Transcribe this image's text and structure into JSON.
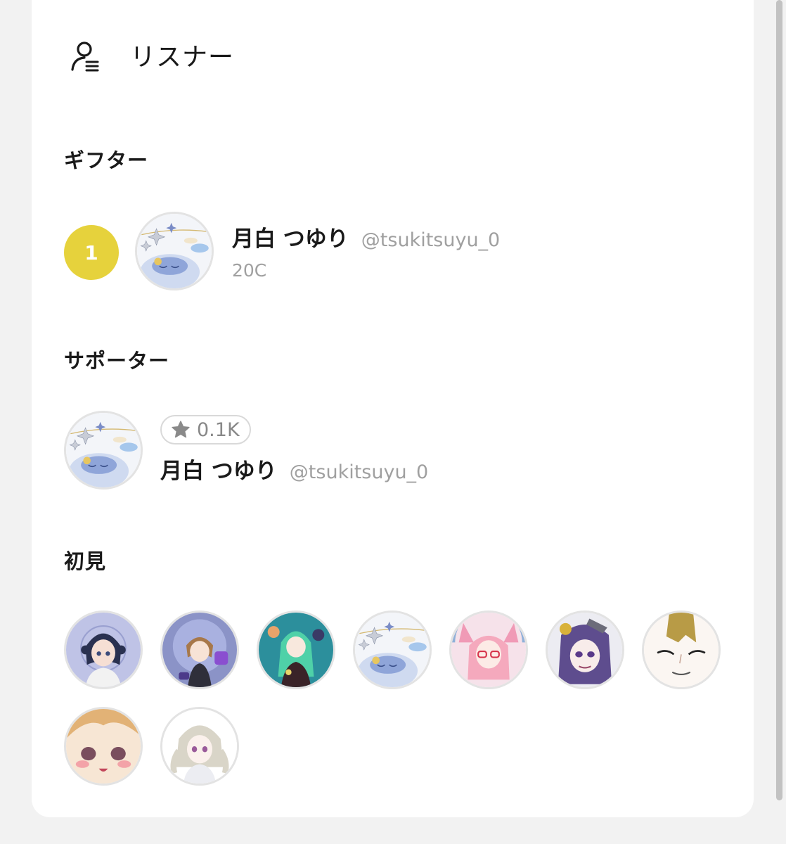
{
  "header": {
    "title": "リスナー",
    "icon": "listener-icon"
  },
  "gifters": {
    "title": "ギフター",
    "items": [
      {
        "rank": "1",
        "name": "月白 つゆり",
        "handle": "@tsukitsuyu_0",
        "amount": "20C",
        "rank_color": "#e6d23c"
      }
    ]
  },
  "supporters": {
    "title": "サポーター",
    "items": [
      {
        "name": "月白 つゆり",
        "handle": "@tsukitsuyu_0",
        "stars": "0.1K",
        "star_icon": "star-icon"
      }
    ]
  },
  "first_timers": {
    "title": "初見",
    "count": 9
  }
}
